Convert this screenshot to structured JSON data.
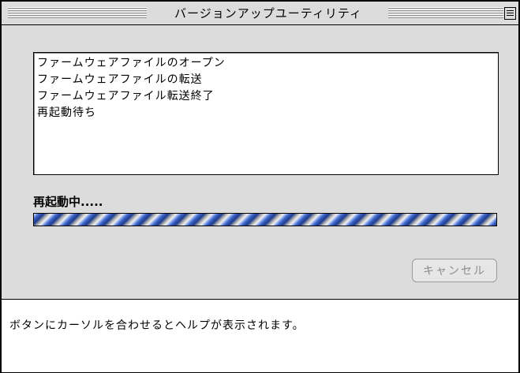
{
  "window": {
    "title": "バージョンアップユーティリティ"
  },
  "log": {
    "lines": [
      "ファームウェアファイルのオープン",
      "ファームウェアファイルの転送",
      "ファームウェアファイル転送終了",
      "再起動待ち"
    ]
  },
  "status": {
    "text": "再起動中....."
  },
  "progress": {
    "state": "indeterminate"
  },
  "buttons": {
    "cancel_label": "キャンセル"
  },
  "help": {
    "text": "ボタンにカーソルを合わせるとヘルプが表示されます。"
  }
}
